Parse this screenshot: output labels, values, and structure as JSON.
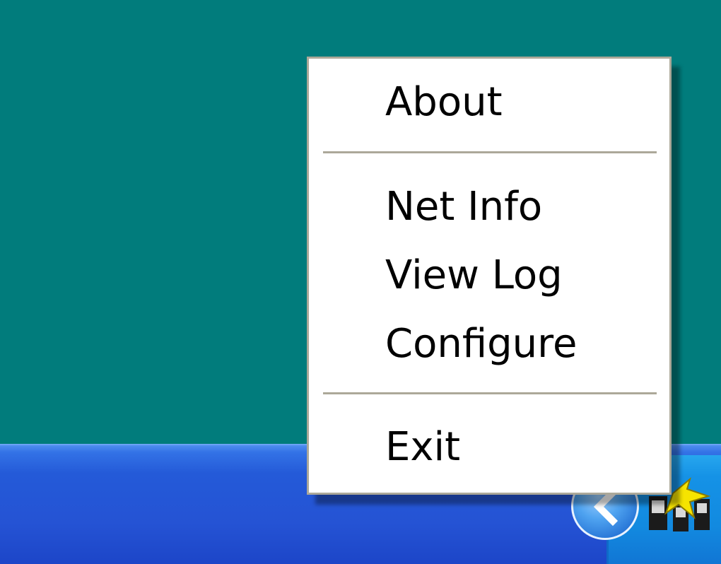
{
  "desktop": {
    "background_color": "#017c7c"
  },
  "taskbar": {
    "color": "#245ad8",
    "tray_color": "#128ae0",
    "show_hidden_icons_button": "chevron-left-icon",
    "tray_app_icon": "network-tray-icon"
  },
  "context_menu": {
    "items": [
      {
        "label": "About"
      },
      {
        "separator": true
      },
      {
        "label": "Net Info"
      },
      {
        "label": "View Log"
      },
      {
        "label": "Configure"
      },
      {
        "separator": true
      },
      {
        "label": "Exit"
      }
    ]
  }
}
